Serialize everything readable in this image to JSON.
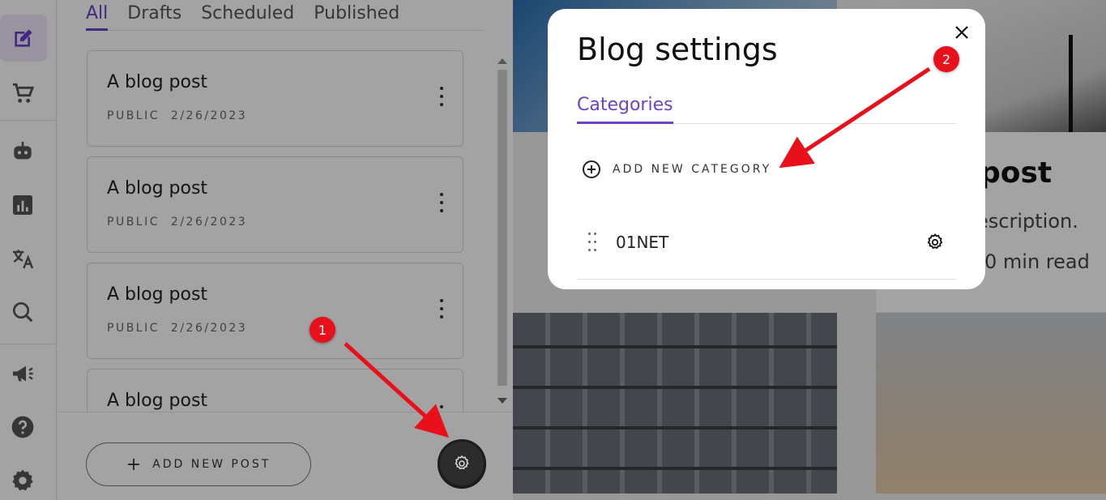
{
  "sidebar": {
    "icons": [
      "edit-icon",
      "cart-icon",
      "robot-icon",
      "analytics-icon",
      "translate-icon",
      "search-icon",
      "megaphone-icon",
      "help-icon",
      "settings-icon"
    ],
    "active_color": "#6a43c9"
  },
  "posts_panel": {
    "tabs": [
      {
        "label": "All",
        "active": true
      },
      {
        "label": "Drafts",
        "active": false
      },
      {
        "label": "Scheduled",
        "active": false
      },
      {
        "label": "Published",
        "active": false
      }
    ],
    "posts": [
      {
        "title": "A blog post",
        "visibility": "PUBLIC",
        "date": "2/26/2023"
      },
      {
        "title": "A blog post",
        "visibility": "PUBLIC",
        "date": "2/26/2023"
      },
      {
        "title": "A blog post",
        "visibility": "PUBLIC",
        "date": "2/26/2023"
      },
      {
        "title": "A blog post",
        "visibility": "",
        "date": ""
      }
    ],
    "add_post_label": "ADD NEW POST",
    "add_post_icon": "plus-icon",
    "settings_icon": "gear-icon"
  },
  "preview": {
    "card_title": "post",
    "card_description": "escription.",
    "card_read_time": "0 min read"
  },
  "modal": {
    "title": "Blog settings",
    "close_icon": "close-icon",
    "tabs": [
      {
        "label": "Categories",
        "active": true
      }
    ],
    "add_category_label": "ADD NEW CATEGORY",
    "add_category_icon": "add-circle-icon",
    "categories": [
      {
        "name": "01NET",
        "drag_icon": "drag-handle-icon",
        "settings_icon": "gear-icon"
      }
    ]
  },
  "annotations": {
    "badges": [
      {
        "label": "1"
      },
      {
        "label": "2"
      }
    ],
    "color": "#e8101a"
  },
  "colors": {
    "accent": "#6a43c9",
    "overlay": "rgba(0,0,0,0.36)"
  }
}
